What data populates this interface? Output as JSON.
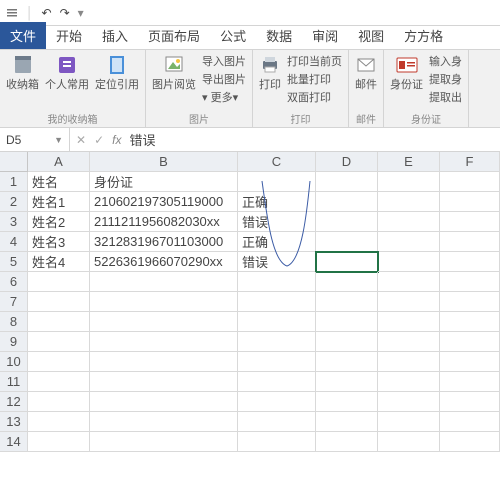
{
  "qat": {
    "undo": "↶",
    "redo": "↷",
    "dd": "▾"
  },
  "tabs": [
    "文件",
    "开始",
    "插入",
    "页面布局",
    "公式",
    "数据",
    "审阅",
    "视图",
    "方方格"
  ],
  "ribbon": {
    "g1": {
      "b1": "收纳箱",
      "b2": "个人常用",
      "b3": "定位引用",
      "label": "我的收纳箱"
    },
    "g2": {
      "b1": "图片阅览",
      "m1": "导入图片",
      "m2": "导出图片",
      "m3": "▾ 更多▾",
      "label": "图片"
    },
    "g3": {
      "b1": "打印",
      "m1": "打印当前页",
      "m2": "批量打印",
      "m3": "双面打印",
      "label": "打印"
    },
    "g4": {
      "b1": "邮件",
      "label": "邮件"
    },
    "g5": {
      "b1": "身份证",
      "m1": "输入身",
      "m2": "提取身",
      "m3": "提取出",
      "label": "身份证"
    }
  },
  "namebox": {
    "ref": "D5",
    "formula": "错误"
  },
  "cols": [
    "A",
    "B",
    "C",
    "D",
    "E",
    "F"
  ],
  "rows": [
    "1",
    "2",
    "3",
    "4",
    "5",
    "6",
    "7",
    "8",
    "9",
    "10",
    "11",
    "12",
    "13",
    "14"
  ],
  "cells": {
    "A1": "姓名",
    "B1": "身份证",
    "A2": "姓名1",
    "B2": "210602197305119000",
    "C2": "正确",
    "A3": "姓名2",
    "B3": "2111211956082030xx",
    "C3": "错误",
    "A4": "姓名3",
    "B4": "321283196701103000",
    "C4": "正确",
    "A5": "姓名4",
    "B5": "5226361966070290xx",
    "C5": "错误"
  },
  "selected": "D5"
}
